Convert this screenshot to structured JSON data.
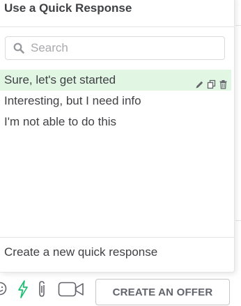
{
  "popover": {
    "title": "Use a Quick Response",
    "search": {
      "placeholder": "Search",
      "value": "",
      "icon": "search-icon"
    },
    "responses": [
      {
        "label": "Sure, let's get started",
        "selected": true
      },
      {
        "label": "Interesting, but I need info",
        "selected": false
      },
      {
        "label": "I'm not able to do this",
        "selected": false
      }
    ],
    "row_actions": [
      "edit-icon",
      "duplicate-icon",
      "delete-icon"
    ],
    "create_label": "Create a new quick response"
  },
  "toolbar": {
    "icons": [
      "emoji-icon",
      "lightning-icon",
      "paperclip-icon",
      "video-icon"
    ],
    "offer_button_label": "CREATE AN OFFER"
  },
  "colors": {
    "selected_row_bg": "#e1f7e4",
    "lightning_green": "#1dbf73",
    "text": "#404145",
    "border": "#dadbdd"
  }
}
